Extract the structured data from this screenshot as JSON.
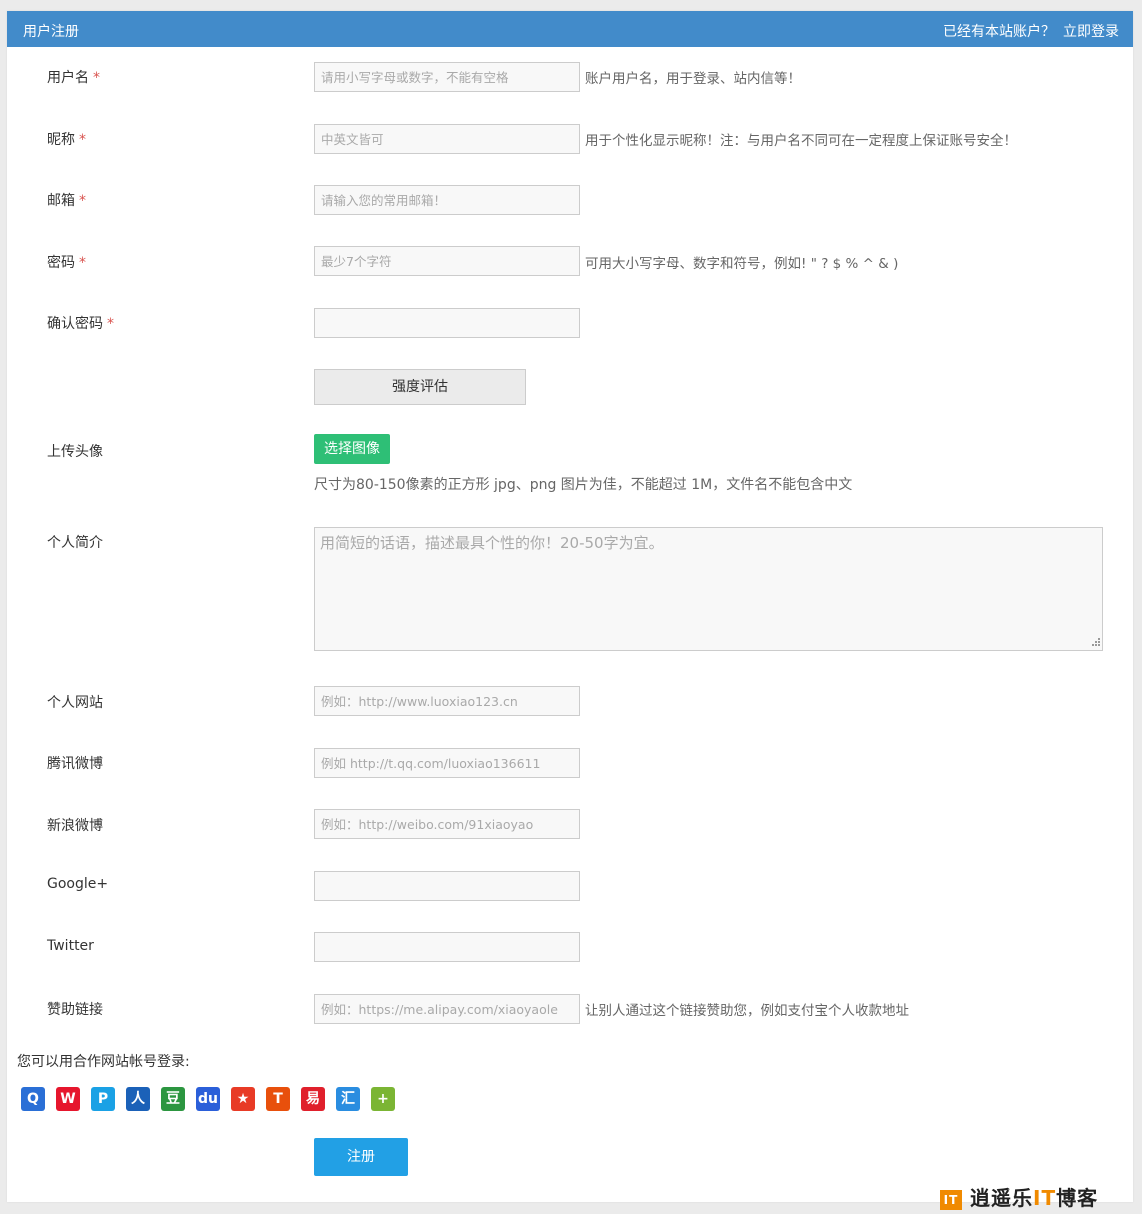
{
  "header": {
    "title": "用户注册",
    "has_account": "已经有本站账户？",
    "login_link": "立即登录"
  },
  "form": {
    "username": {
      "label": "用户名",
      "required_mark": "*",
      "placeholder": "请用小写字母或数字，不能有空格",
      "hint": "账户用户名，用于登录、站内信等！"
    },
    "nickname": {
      "label": "昵称",
      "required_mark": "*",
      "placeholder": "中英文皆可",
      "hint": "用于个性化显示昵称！注：与用户名不同可在一定程度上保证账号安全！"
    },
    "email": {
      "label": "邮箱",
      "required_mark": "*",
      "placeholder": "请输入您的常用邮箱！"
    },
    "password": {
      "label": "密码",
      "required_mark": "*",
      "placeholder": "最少7个字符",
      "hint": "可用大小写字母、数字和符号，例如! \" ? $ % ^ & )"
    },
    "confirm_password": {
      "label": "确认密码",
      "required_mark": "*",
      "placeholder": ""
    },
    "strength_button": "强度评估",
    "avatar": {
      "label": "上传头像",
      "button": "选择图像",
      "note": "尺寸为80-150像素的正方形 jpg、png 图片为佳，不能超过 1M，文件名不能包含中文"
    },
    "bio": {
      "label": "个人简介",
      "placeholder": "用简短的话语，描述最具个性的你！20-50字为宜。"
    },
    "website": {
      "label": "个人网站",
      "placeholder": "例如：http://www.luoxiao123.cn"
    },
    "tencent_weibo": {
      "label": "腾讯微博",
      "placeholder": "例如 http://t.qq.com/luoxiao136611"
    },
    "sina_weibo": {
      "label": "新浪微博",
      "placeholder": "例如：http://weibo.com/91xiaoyao"
    },
    "google_plus": {
      "label": "Google+",
      "placeholder": ""
    },
    "twitter": {
      "label": "Twitter",
      "placeholder": ""
    },
    "donate": {
      "label": "赞助链接",
      "placeholder": "例如：https://me.alipay.com/xiaoyaole",
      "hint": "让别人通过这个链接赞助您，例如支付宝个人收款地址"
    }
  },
  "social": {
    "title": "您可以用合作网站帐号登录:",
    "icons": [
      {
        "name": "qq-icon",
        "glyph": "Q",
        "color": "#2a6fd6"
      },
      {
        "name": "sina-weibo-icon",
        "glyph": "W",
        "color": "#e6162d"
      },
      {
        "name": "tencent-weibo-icon",
        "glyph": "P",
        "color": "#1aa1e5"
      },
      {
        "name": "renren-icon",
        "glyph": "人",
        "color": "#1b61b8"
      },
      {
        "name": "douban-icon",
        "glyph": "豆",
        "color": "#2c9640"
      },
      {
        "name": "baidu-icon",
        "glyph": "du",
        "color": "#2b5fd9"
      },
      {
        "name": "kaixin-icon",
        "glyph": "★",
        "color": "#e83b26"
      },
      {
        "name": "tianya-icon",
        "glyph": "T",
        "color": "#e8500c"
      },
      {
        "name": "netease-icon",
        "glyph": "易",
        "color": "#e0202c"
      },
      {
        "name": "huiju-icon",
        "glyph": "汇",
        "color": "#2a8de0"
      },
      {
        "name": "add-more-icon",
        "glyph": "+",
        "color": "#7bb534"
      }
    ]
  },
  "submit_button": "注册",
  "watermark": {
    "logo": "IT",
    "prefix": "逍遥乐",
    "highlight": "IT",
    "suffix": "博客"
  }
}
